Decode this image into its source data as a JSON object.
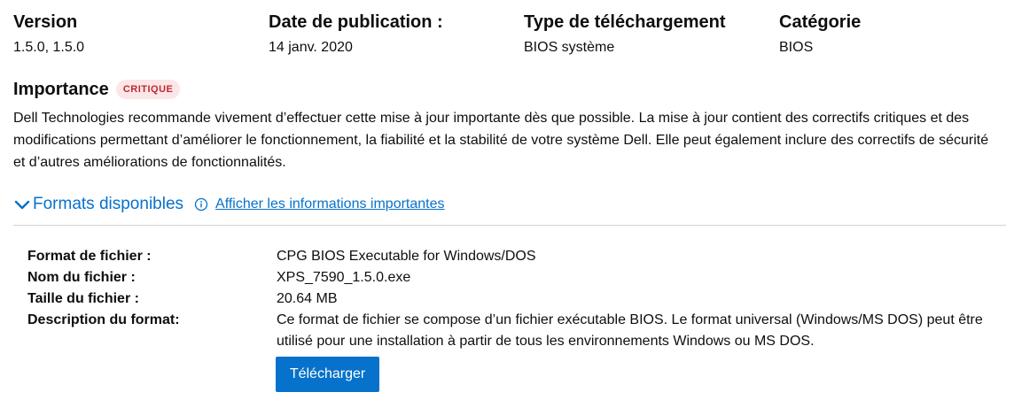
{
  "meta": {
    "version_label": "Version",
    "version_value": "1.5.0, 1.5.0",
    "date_label": "Date de publication :",
    "date_value": "14 janv. 2020",
    "type_label": "Type de téléchargement",
    "type_value": "BIOS système",
    "category_label": "Catégorie",
    "category_value": "BIOS"
  },
  "importance": {
    "title": "Importance",
    "badge": "CRITIQUE",
    "description": "Dell Technologies recommande vivement d’effectuer cette mise à jour importante dès que possible. La mise à jour contient des correctifs critiques et des modifications permettant d’améliorer le fonctionnement, la fiabilité et la stabilité de votre système Dell. Elle peut également inclure des correctifs de sécurité et d’autres améliorations de fonctionnalités."
  },
  "formats": {
    "title": "Formats disponibles",
    "info_link": "Afficher les informations importantes",
    "chevron_icon": "chevron-down-icon",
    "info_icon": "info-icon",
    "accent_color": "#0672cb"
  },
  "details": {
    "file_format_label": "Format de fichier :",
    "file_format_value": "CPG BIOS Executable for Windows/DOS",
    "file_name_label": "Nom du fichier :",
    "file_name_value": "XPS_7590_1.5.0.exe",
    "file_size_label": "Taille du fichier :",
    "file_size_value": "20.64 MB",
    "description_label": "Description du format:",
    "description_value": "Ce format de fichier se compose d’un fichier exécutable BIOS. Le format universal (Windows/MS DOS) peut être utilisé pour une installation à partir de tous les environnements Windows ou MS DOS."
  },
  "download": {
    "label": "Télécharger"
  }
}
